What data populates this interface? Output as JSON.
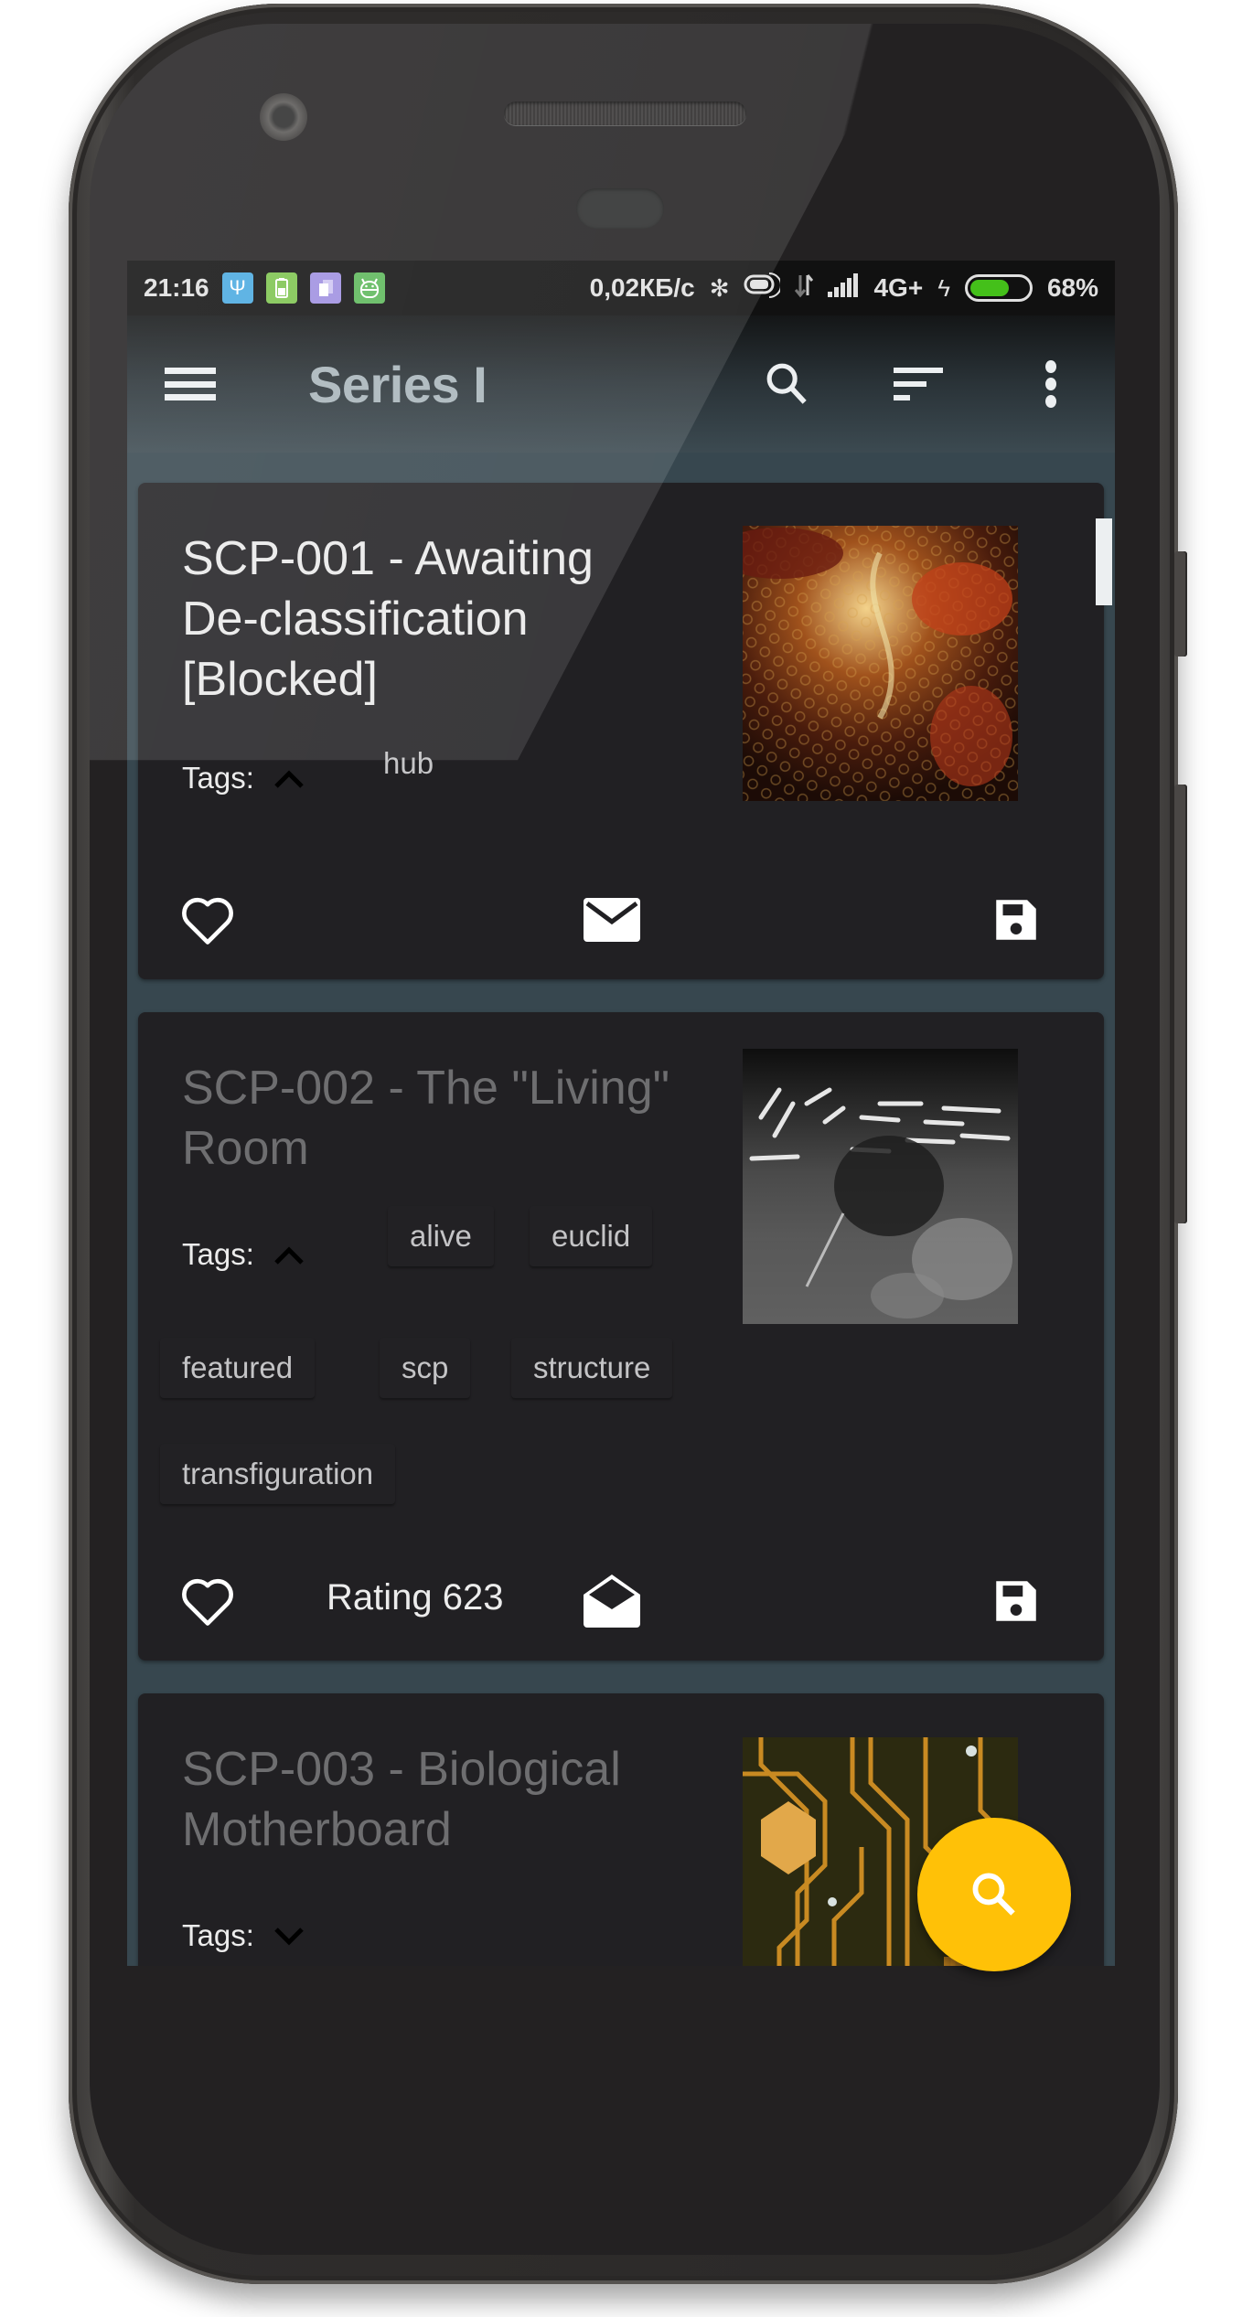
{
  "status_bar": {
    "time": "21:16",
    "left_icons": [
      {
        "name": "usb-icon",
        "glyph": "Ψ",
        "color": "#4aa9e0"
      },
      {
        "name": "battery-saver-icon",
        "glyph": "▮",
        "color": "#7dc44e"
      },
      {
        "name": "clipboard-icon",
        "glyph": "❐",
        "color": "#9e8fe0"
      },
      {
        "name": "android-icon",
        "glyph": "☺",
        "color": "#5db85a"
      }
    ],
    "network_speed": "0,02КБ/с",
    "bluetooth_icon": "✻",
    "network_type": "4G+",
    "charging_icon": "ϟ",
    "battery_percent": "68%",
    "battery_level": 0.68,
    "battery_color": "#44c01a"
  },
  "toolbar": {
    "title": "Series I",
    "menu_icon": "menu-icon",
    "actions": [
      "search-icon",
      "sort-icon",
      "more-vert-icon"
    ]
  },
  "articles": [
    {
      "title": "SCP-001 - Awaiting De-classification [Blocked]",
      "title_lines": [
        "SCP-001 - Awaiting",
        "De-classification",
        "[Blocked]"
      ],
      "read": true,
      "tags_label": "Tags:",
      "tags_expanded": true,
      "tags": [
        "hub"
      ],
      "rating": null,
      "mail_icon": "mail-closed-icon",
      "image_theme": "fractal-red-gold"
    },
    {
      "title": "SCP-002 - The \"Living\" Room",
      "title_lines": [
        "SCP-002 - The \"Living\"",
        "Room"
      ],
      "read": false,
      "tags_label": "Tags:",
      "tags_expanded": true,
      "tags": [
        "alive",
        "euclid",
        "featured",
        "scp",
        "structure",
        "transfiguration"
      ],
      "rating_label": "Rating 623",
      "rating": 623,
      "mail_icon": "mail-open-icon",
      "image_theme": "warehouse-grayscale"
    },
    {
      "title": "SCP-003 - Biological Motherboard",
      "title_lines": [
        "SCP-003 - Biological",
        "Motherboard"
      ],
      "read": false,
      "tags_label": "Tags:",
      "tags_expanded": false,
      "tags": [],
      "image_theme": "circuit-board-gold"
    }
  ],
  "fab": {
    "icon": "search-icon",
    "color": "#ffc107"
  },
  "colors": {
    "list_background": "#37474f",
    "card_background": "#212023",
    "accent": "#ffc107"
  }
}
